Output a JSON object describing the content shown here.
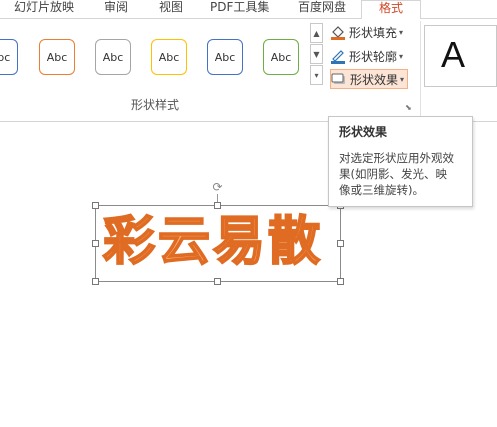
{
  "tabs": {
    "slideshow": "幻灯片放映",
    "review": "审阅",
    "view": "视图",
    "pdf_tools": "PDF工具集",
    "baidu_pan": "百度网盘",
    "format": "格式"
  },
  "shape_styles": {
    "items": [
      {
        "label": "Abc",
        "color": "#4472c4"
      },
      {
        "label": "Abc",
        "color": "#ed7d31"
      },
      {
        "label": "Abc",
        "color": "#a5a5a5"
      },
      {
        "label": "Abc",
        "color": "#ffc000"
      },
      {
        "label": "Abc",
        "color": "#4472c4"
      },
      {
        "label": "Abc",
        "color": "#70ad47"
      }
    ],
    "group_label": "形状样式"
  },
  "commands": {
    "shape_fill": "形状填充",
    "shape_outline": "形状轮廓",
    "shape_effects": "形状效果"
  },
  "wordart": {
    "sample": "A"
  },
  "tooltip": {
    "title": "形状效果",
    "lines": [
      "对选定形状应用外观效",
      "果(如阴影、发光、映",
      "像或三维旋转)。"
    ]
  },
  "slide": {
    "text": "彩云易散",
    "text_fill": "#ffb27a",
    "text_outline": "#e06b22"
  },
  "colors": {
    "accent": "#d24726",
    "active_bg": "#fce4d6"
  }
}
